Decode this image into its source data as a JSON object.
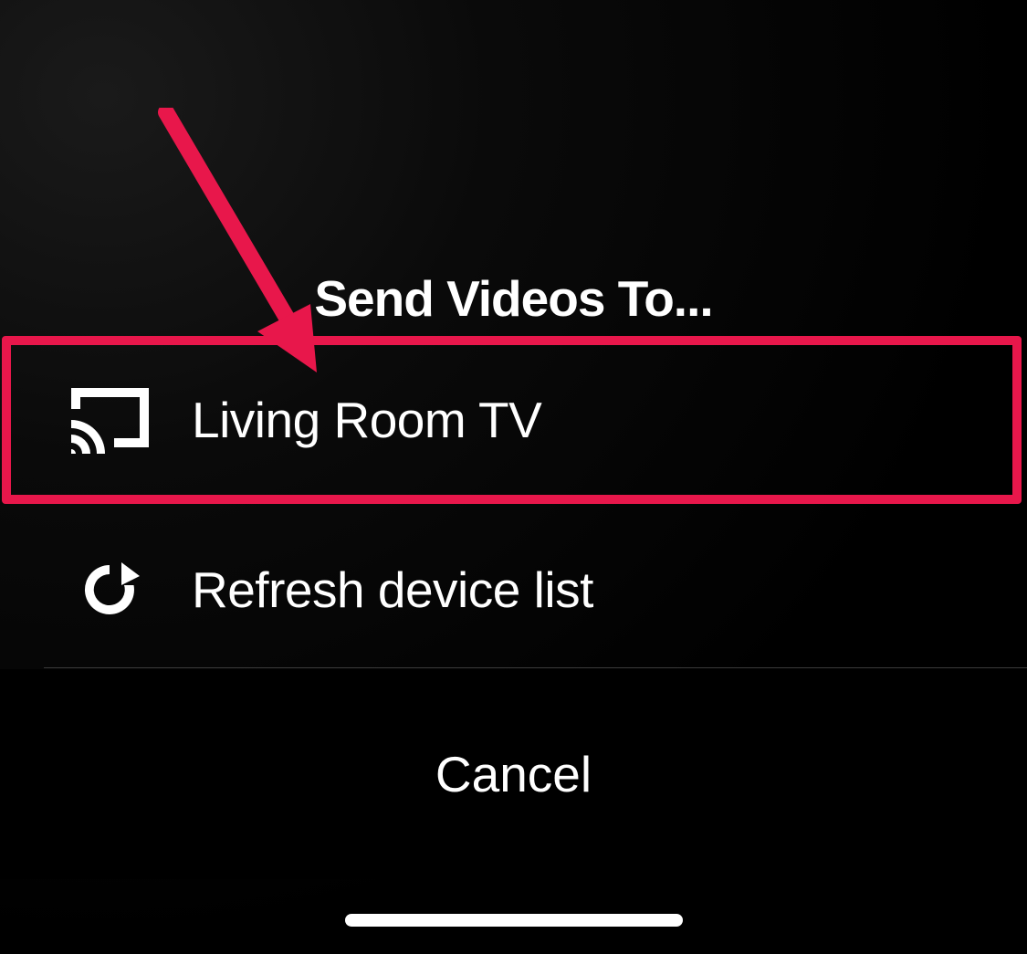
{
  "dialog": {
    "title": "Send Videos To...",
    "cancel_label": "Cancel"
  },
  "devices": [
    {
      "label": "Living Room TV"
    }
  ],
  "actions": {
    "refresh_label": "Refresh device list"
  },
  "annotation": {
    "highlight_color": "#e8174b"
  }
}
